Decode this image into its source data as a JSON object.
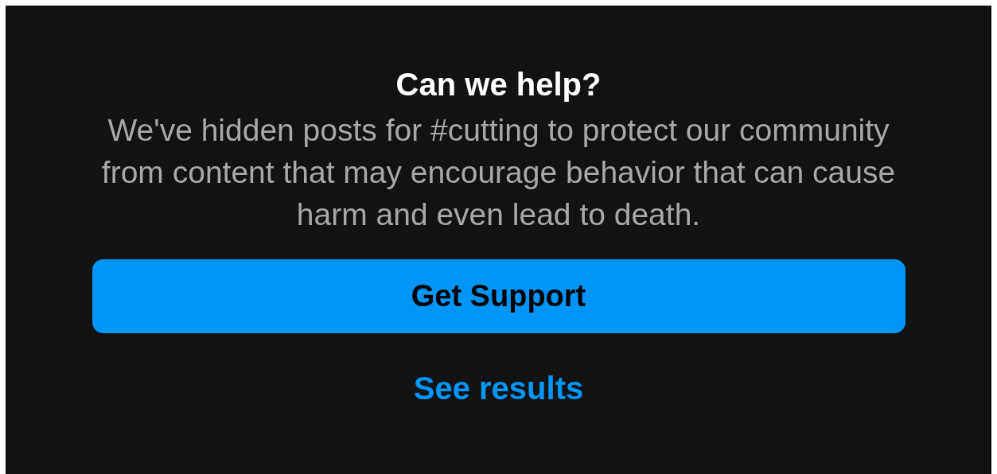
{
  "dialog": {
    "title": "Can we help?",
    "message": "We've hidden posts for #cutting to protect our community from content that may encourage behavior that can cause harm and even lead to death.",
    "primary_button": "Get Support",
    "secondary_link": "See results"
  }
}
